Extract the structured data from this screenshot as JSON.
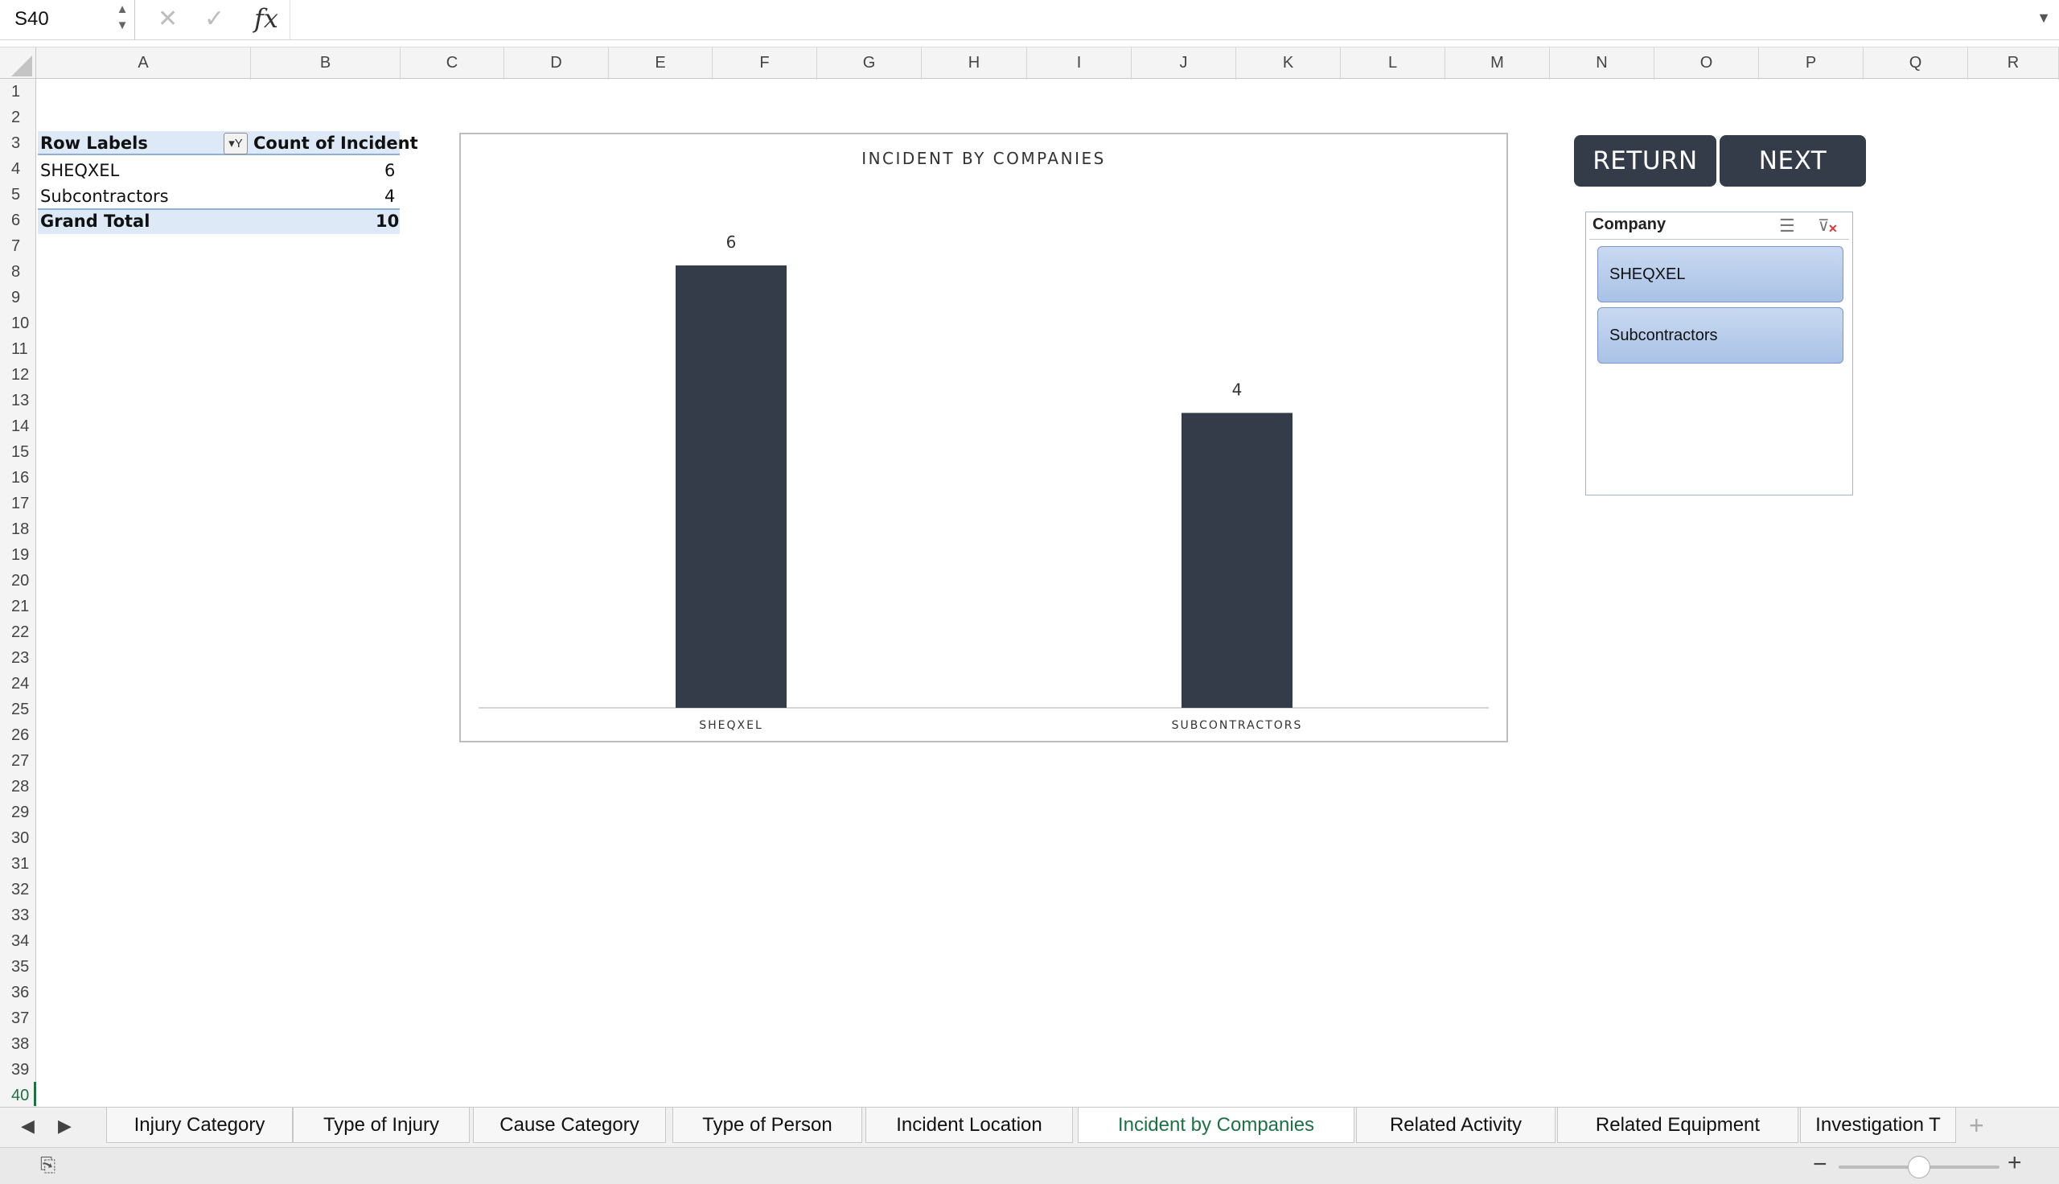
{
  "formula_bar": {
    "name_box": "S40",
    "cancel_glyph": "✕",
    "enter_glyph": "✓",
    "fx_label": "fx",
    "formula": ""
  },
  "columns": [
    "A",
    "B",
    "C",
    "D",
    "E",
    "F",
    "G",
    "H",
    "I",
    "J",
    "K",
    "L",
    "M",
    "N",
    "O",
    "P",
    "Q",
    "R"
  ],
  "rows": [
    "1",
    "2",
    "3",
    "4",
    "5",
    "6",
    "7",
    "8",
    "9",
    "10",
    "11",
    "12",
    "13",
    "14",
    "15",
    "16",
    "17",
    "18",
    "19",
    "20",
    "21",
    "22",
    "23",
    "24",
    "25",
    "26",
    "27",
    "28",
    "29",
    "30",
    "31",
    "32",
    "33",
    "34",
    "35",
    "36",
    "37",
    "38",
    "39",
    "40"
  ],
  "pivot": {
    "header_label": "Row Labels",
    "header_value": "Count of Incident",
    "rows": [
      {
        "label": "SHEQXEL",
        "value": "6"
      },
      {
        "label": "Subcontractors",
        "value": "4"
      }
    ],
    "total_label": "Grand Total",
    "total_value": "10"
  },
  "chart_data": {
    "type": "bar",
    "title": "INCIDENT BY COMPANIES",
    "categories": [
      "SHEQXEL",
      "SUBCONTRACTORS"
    ],
    "values": [
      6,
      4
    ],
    "data_labels": [
      "6",
      "4"
    ],
    "ylim": [
      0,
      6.5
    ],
    "grid": false,
    "legend": "none",
    "bar_color": "#343c4a"
  },
  "buttons": {
    "return_label": "RETURN",
    "next_label": "NEXT"
  },
  "slicer": {
    "title": "Company",
    "items": [
      "SHEQXEL",
      "Subcontractors"
    ]
  },
  "sheet_tabs": [
    {
      "label": "Injury Category",
      "active": false
    },
    {
      "label": "Type of Injury",
      "active": false
    },
    {
      "label": "Cause Category",
      "active": false
    },
    {
      "label": "Type of Person",
      "active": false
    },
    {
      "label": "Incident Location",
      "active": false
    },
    {
      "label": "Incident by Companies",
      "active": true
    },
    {
      "label": "Related Activity",
      "active": false
    },
    {
      "label": "Related Equipment",
      "active": false
    },
    {
      "label": "Investigation T",
      "active": false
    }
  ],
  "colors": {
    "accent": "#1e7145",
    "bar": "#343c4a",
    "pivot_band": "#dde9f6"
  }
}
